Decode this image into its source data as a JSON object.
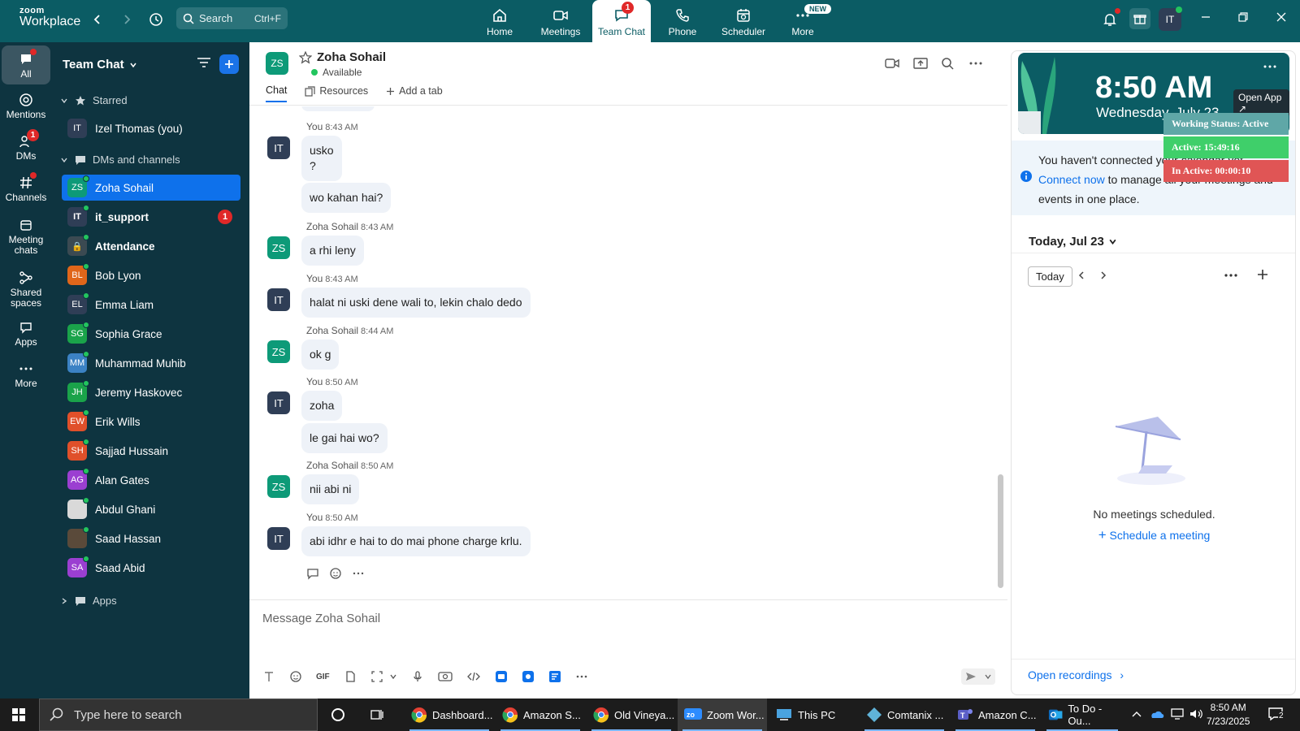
{
  "brand": {
    "line1": "zoom",
    "line2": "Workplace"
  },
  "search": {
    "label": "Search",
    "shortcut": "Ctrl+F"
  },
  "nav": {
    "tabs": [
      {
        "label": "Home"
      },
      {
        "label": "Meetings"
      },
      {
        "label": "Team Chat",
        "badge": "1"
      },
      {
        "label": "Phone"
      },
      {
        "label": "Scheduler"
      },
      {
        "label": "More",
        "badge": "NEW"
      }
    ]
  },
  "top_avatar": "IT",
  "rail": {
    "items": [
      {
        "label": "All"
      },
      {
        "label": "Mentions"
      },
      {
        "label": "DMs",
        "badge": "1"
      },
      {
        "label": "Channels"
      },
      {
        "label": "Meeting chats"
      },
      {
        "label": "Shared spaces"
      },
      {
        "label": "Apps"
      },
      {
        "label": "More"
      }
    ]
  },
  "panel": {
    "title": "Team Chat",
    "sections": {
      "starred": "Starred",
      "dms": "DMs and channels",
      "apps": "Apps"
    },
    "starred": [
      {
        "initials": "IT",
        "name": "Izel Thomas (you)",
        "color": "#2f3e56"
      }
    ],
    "channels": [
      {
        "initials": "ZS",
        "name": "Zoha Sohail",
        "color": "#0d9a78",
        "selected": true
      },
      {
        "initials": "IT",
        "name": "it_support",
        "color": "#2f3e56",
        "badge": "1",
        "bold": true
      },
      {
        "initials": "🔒",
        "name": "Attendance",
        "color": "#3b4a52",
        "bold": true
      },
      {
        "initials": "BL",
        "name": "Bob Lyon",
        "color": "#e0661a"
      },
      {
        "initials": "EL",
        "name": "Emma Liam",
        "color": "#2f3e56"
      },
      {
        "initials": "SG",
        "name": "Sophia Grace",
        "color": "#1aa34a"
      },
      {
        "initials": "MM",
        "name": "Muhammad Muhib",
        "color": "#3b82c4"
      },
      {
        "initials": "JH",
        "name": "Jeremy Haskovec",
        "color": "#1aa34a"
      },
      {
        "initials": "EW",
        "name": "Erik Wills",
        "color": "#e0502a"
      },
      {
        "initials": "SH",
        "name": "Sajjad Hussain",
        "color": "#e0502a"
      },
      {
        "initials": "AG",
        "name": "Alan Gates",
        "color": "#9b3fd1"
      },
      {
        "initials": "",
        "name": "Abdul Ghani",
        "color": "#d9d9d9"
      },
      {
        "initials": "",
        "name": "Saad Hassan",
        "color": "#5a4a3a"
      },
      {
        "initials": "SA",
        "name": "Saad Abid",
        "color": "#9b3fd1"
      }
    ]
  },
  "chat": {
    "contact_initials": "ZS",
    "contact_name": "Zoha Sohail",
    "status": "Available",
    "tabs": [
      "Chat",
      "Resources",
      "Add a tab"
    ],
    "messages": [
      {
        "sender": "You",
        "time": "8:43 AM",
        "initials": "IT",
        "color": "#2f3e56",
        "texts": [
          "usko\n?",
          "wo kahan hai?"
        ]
      },
      {
        "sender": "Zoha Sohail",
        "time": "8:43 AM",
        "initials": "ZS",
        "color": "#0d9a78",
        "texts": [
          "a rhi leny"
        ]
      },
      {
        "sender": "You",
        "time": "8:43 AM",
        "initials": "IT",
        "color": "#2f3e56",
        "texts": [
          "halat ni uski dene wali to, lekin chalo dedo"
        ]
      },
      {
        "sender": "Zoha Sohail",
        "time": "8:44 AM",
        "initials": "ZS",
        "color": "#0d9a78",
        "texts": [
          "ok g"
        ]
      },
      {
        "sender": "You",
        "time": "8:50 AM",
        "initials": "IT",
        "color": "#2f3e56",
        "texts": [
          "zoha",
          "le gai hai wo?"
        ]
      },
      {
        "sender": "Zoha Sohail",
        "time": "8:50 AM",
        "initials": "ZS",
        "color": "#0d9a78",
        "texts": [
          "nii abi ni"
        ]
      },
      {
        "sender": "You",
        "time": "8:50 AM",
        "initials": "IT",
        "color": "#2f3e56",
        "texts": [
          "abi idhr e hai to do mai phone charge krlu."
        ]
      }
    ],
    "composer_placeholder": "Message Zoha Sohail",
    "gif_label": "GIF"
  },
  "right": {
    "clock_time": "8:50 AM",
    "clock_date": "Wednesday, July 23",
    "open_app": "Open App ↗",
    "notice_pre": "You haven't connected your calendar yet. ",
    "notice_link": "Connect now",
    "notice_post": " to manage all your meetings and events in one place.",
    "today_header": "Today, Jul 23",
    "today_button": "Today",
    "no_meetings": "No meetings scheduled.",
    "schedule": "Schedule a meeting",
    "open_recordings": "Open recordings"
  },
  "work_status": {
    "title": "Working Status: Active",
    "active": "Active: 15:49:16",
    "inactive": "In Active: 00:00:10"
  },
  "taskbar": {
    "search_placeholder": "Type here to search",
    "apps": [
      {
        "label": "Dashboard..."
      },
      {
        "label": "Amazon S..."
      },
      {
        "label": "Old Vineya..."
      },
      {
        "label": "Zoom Wor..."
      },
      {
        "label": "This PC"
      },
      {
        "label": "Comtanix ..."
      },
      {
        "label": "Amazon C..."
      },
      {
        "label": "To Do - Ou..."
      }
    ],
    "time": "8:50 AM",
    "date": "7/23/2025",
    "notif_count": "2"
  }
}
